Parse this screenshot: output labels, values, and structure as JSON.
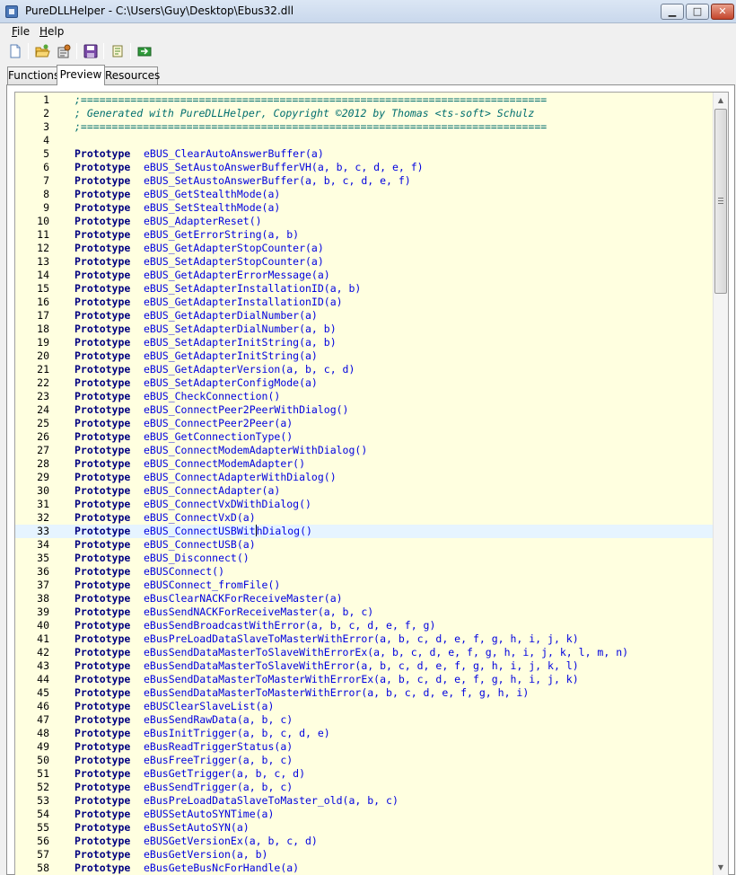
{
  "window": {
    "title": "PureDLLHelper - C:\\Users\\Guy\\Desktop\\Ebus32.dll",
    "minimize_label": "▁",
    "maximize_label": "□",
    "close_label": "✕"
  },
  "menu": {
    "file_first": "F",
    "file_rest": "ile",
    "help_first": "H",
    "help_rest": "elp"
  },
  "toolbar": {
    "icons": [
      "new-document-icon",
      "open-folder-icon",
      "settings-icon",
      "save-icon",
      "view-icon",
      "export-icon"
    ]
  },
  "tabs": [
    {
      "label": "Functions"
    },
    {
      "label": "Preview",
      "selected": true
    },
    {
      "label": "Resources"
    }
  ],
  "editor": {
    "current_line": 33,
    "cursor_after": "eBUS_ConnectUSBWit",
    "lines": [
      {
        "n": "1",
        "type": "comment",
        "text": ";==========================================================================="
      },
      {
        "n": "2",
        "type": "comment",
        "text": "; Generated with PureDLLHelper, Copyright ©2012 by Thomas <ts-soft> Schulz"
      },
      {
        "n": "3",
        "type": "comment",
        "text": ";==========================================================================="
      },
      {
        "n": "4",
        "type": "blank",
        "text": ""
      },
      {
        "n": "5",
        "type": "proto",
        "kw": "Prototype",
        "text": "eBUS_ClearAutoAnswerBuffer(a)"
      },
      {
        "n": "6",
        "type": "proto",
        "kw": "Prototype",
        "text": "eBUS_SetAustoAnswerBufferVH(a, b, c, d, e, f)"
      },
      {
        "n": "7",
        "type": "proto",
        "kw": "Prototype",
        "text": "eBUS_SetAustoAnswerBuffer(a, b, c, d, e, f)"
      },
      {
        "n": "8",
        "type": "proto",
        "kw": "Prototype",
        "text": "eBUS_GetStealthMode(a)"
      },
      {
        "n": "9",
        "type": "proto",
        "kw": "Prototype",
        "text": "eBUS_SetStealthMode(a)"
      },
      {
        "n": "10",
        "type": "proto",
        "kw": "Prototype",
        "text": "eBUS_AdapterReset()"
      },
      {
        "n": "11",
        "type": "proto",
        "kw": "Prototype",
        "text": "eBUS_GetErrorString(a, b)"
      },
      {
        "n": "12",
        "type": "proto",
        "kw": "Prototype",
        "text": "eBUS_GetAdapterStopCounter(a)"
      },
      {
        "n": "13",
        "type": "proto",
        "kw": "Prototype",
        "text": "eBUS_SetAdapterStopCounter(a)"
      },
      {
        "n": "14",
        "type": "proto",
        "kw": "Prototype",
        "text": "eBUS_GetAdapterErrorMessage(a)"
      },
      {
        "n": "15",
        "type": "proto",
        "kw": "Prototype",
        "text": "eBUS_SetAdapterInstallationID(a, b)"
      },
      {
        "n": "16",
        "type": "proto",
        "kw": "Prototype",
        "text": "eBUS_GetAdapterInstallationID(a)"
      },
      {
        "n": "17",
        "type": "proto",
        "kw": "Prototype",
        "text": "eBUS_GetAdapterDialNumber(a)"
      },
      {
        "n": "18",
        "type": "proto",
        "kw": "Prototype",
        "text": "eBUS_SetAdapterDialNumber(a, b)"
      },
      {
        "n": "19",
        "type": "proto",
        "kw": "Prototype",
        "text": "eBUS_SetAdapterInitString(a, b)"
      },
      {
        "n": "20",
        "type": "proto",
        "kw": "Prototype",
        "text": "eBUS_GetAdapterInitString(a)"
      },
      {
        "n": "21",
        "type": "proto",
        "kw": "Prototype",
        "text": "eBUS_GetAdapterVersion(a, b, c, d)"
      },
      {
        "n": "22",
        "type": "proto",
        "kw": "Prototype",
        "text": "eBUS_SetAdapterConfigMode(a)"
      },
      {
        "n": "23",
        "type": "proto",
        "kw": "Prototype",
        "text": "eBUS_CheckConnection()"
      },
      {
        "n": "24",
        "type": "proto",
        "kw": "Prototype",
        "text": "eBUS_ConnectPeer2PeerWithDialog()"
      },
      {
        "n": "25",
        "type": "proto",
        "kw": "Prototype",
        "text": "eBUS_ConnectPeer2Peer(a)"
      },
      {
        "n": "26",
        "type": "proto",
        "kw": "Prototype",
        "text": "eBUS_GetConnectionType()"
      },
      {
        "n": "27",
        "type": "proto",
        "kw": "Prototype",
        "text": "eBUS_ConnectModemAdapterWithDialog()"
      },
      {
        "n": "28",
        "type": "proto",
        "kw": "Prototype",
        "text": "eBUS_ConnectModemAdapter()"
      },
      {
        "n": "29",
        "type": "proto",
        "kw": "Prototype",
        "text": "eBUS_ConnectAdapterWithDialog()"
      },
      {
        "n": "30",
        "type": "proto",
        "kw": "Prototype",
        "text": "eBUS_ConnectAdapter(a)"
      },
      {
        "n": "31",
        "type": "proto",
        "kw": "Prototype",
        "text": "eBUS_ConnectVxDWithDialog()"
      },
      {
        "n": "32",
        "type": "proto",
        "kw": "Prototype",
        "text": "eBUS_ConnectVxD(a)"
      },
      {
        "n": "33",
        "type": "proto",
        "kw": "Prototype",
        "text": "eBUS_ConnectUSBWithDialog()"
      },
      {
        "n": "34",
        "type": "proto",
        "kw": "Prototype",
        "text": "eBUS_ConnectUSB(a)"
      },
      {
        "n": "35",
        "type": "proto",
        "kw": "Prototype",
        "text": "eBUS_Disconnect()"
      },
      {
        "n": "36",
        "type": "proto",
        "kw": "Prototype",
        "text": "eBUSConnect()"
      },
      {
        "n": "37",
        "type": "proto",
        "kw": "Prototype",
        "text": "eBUSConnect_fromFile()"
      },
      {
        "n": "38",
        "type": "proto",
        "kw": "Prototype",
        "text": "eBusClearNACKForReceiveMaster(a)"
      },
      {
        "n": "39",
        "type": "proto",
        "kw": "Prototype",
        "text": "eBusSendNACKForReceiveMaster(a, b, c)"
      },
      {
        "n": "40",
        "type": "proto",
        "kw": "Prototype",
        "text": "eBusSendBroadcastWithError(a, b, c, d, e, f, g)"
      },
      {
        "n": "41",
        "type": "proto",
        "kw": "Prototype",
        "text": "eBusPreLoadDataSlaveToMasterWithError(a, b, c, d, e, f, g, h, i, j, k)"
      },
      {
        "n": "42",
        "type": "proto",
        "kw": "Prototype",
        "text": "eBusSendDataMasterToSlaveWithErrorEx(a, b, c, d, e, f, g, h, i, j, k, l, m, n)"
      },
      {
        "n": "43",
        "type": "proto",
        "kw": "Prototype",
        "text": "eBusSendDataMasterToSlaveWithError(a, b, c, d, e, f, g, h, i, j, k, l)"
      },
      {
        "n": "44",
        "type": "proto",
        "kw": "Prototype",
        "text": "eBusSendDataMasterToMasterWithErrorEx(a, b, c, d, e, f, g, h, i, j, k)"
      },
      {
        "n": "45",
        "type": "proto",
        "kw": "Prototype",
        "text": "eBusSendDataMasterToMasterWithError(a, b, c, d, e, f, g, h, i)"
      },
      {
        "n": "46",
        "type": "proto",
        "kw": "Prototype",
        "text": "eBUSClearSlaveList(a)"
      },
      {
        "n": "47",
        "type": "proto",
        "kw": "Prototype",
        "text": "eBusSendRawData(a, b, c)"
      },
      {
        "n": "48",
        "type": "proto",
        "kw": "Prototype",
        "text": "eBusInitTrigger(a, b, c, d, e)"
      },
      {
        "n": "49",
        "type": "proto",
        "kw": "Prototype",
        "text": "eBusReadTriggerStatus(a)"
      },
      {
        "n": "50",
        "type": "proto",
        "kw": "Prototype",
        "text": "eBusFreeTrigger(a, b, c)"
      },
      {
        "n": "51",
        "type": "proto",
        "kw": "Prototype",
        "text": "eBusGetTrigger(a, b, c, d)"
      },
      {
        "n": "52",
        "type": "proto",
        "kw": "Prototype",
        "text": "eBusSendTrigger(a, b, c)"
      },
      {
        "n": "53",
        "type": "proto",
        "kw": "Prototype",
        "text": "eBusPreLoadDataSlaveToMaster_old(a, b, c)"
      },
      {
        "n": "54",
        "type": "proto",
        "kw": "Prototype",
        "text": "eBUSSetAutoSYNTime(a)"
      },
      {
        "n": "55",
        "type": "proto",
        "kw": "Prototype",
        "text": "eBusSetAutoSYN(a)"
      },
      {
        "n": "56",
        "type": "proto",
        "kw": "Prototype",
        "text": "eBUSGetVersionEx(a, b, c, d)"
      },
      {
        "n": "57",
        "type": "proto",
        "kw": "Prototype",
        "text": "eBusGetVersion(a, b)"
      },
      {
        "n": "58",
        "type": "proto",
        "kw": "Prototype",
        "text": "eBusGeteBusNcForHandle(a)"
      }
    ]
  }
}
